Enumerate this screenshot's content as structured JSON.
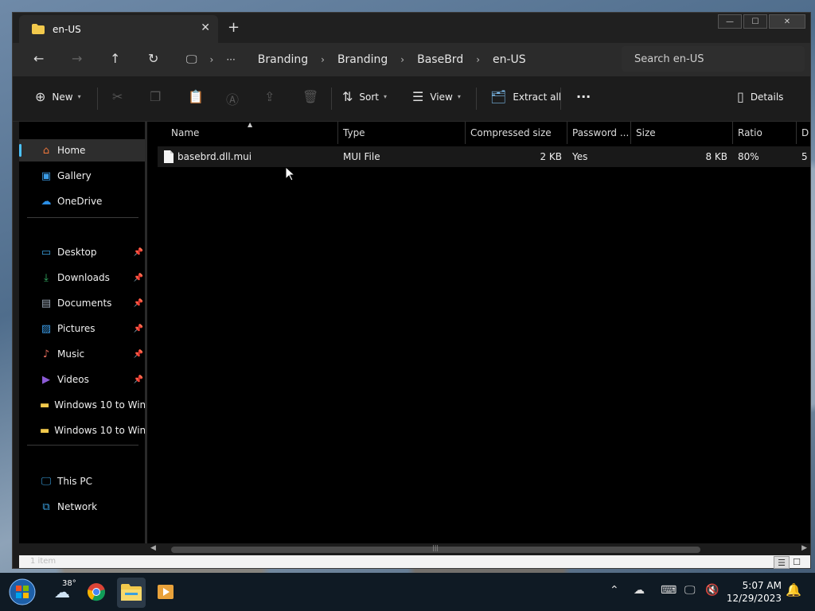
{
  "window": {
    "tab_title": "en-US",
    "tab_close": "✕",
    "new_tab": "+",
    "controls": {
      "minimize": "—",
      "maximize": "☐",
      "close": "✕"
    }
  },
  "nav": {
    "back": "←",
    "forward": "→",
    "up": "↑",
    "refresh": "↻",
    "monitor": "🖵",
    "more": "···",
    "breadcrumb": [
      "Branding",
      "Branding",
      "BaseBrd",
      "en-US"
    ],
    "search_placeholder": "Search en-US"
  },
  "commandbar": {
    "new_label": "New",
    "sort_label": "Sort",
    "view_label": "View",
    "extract_label": "Extract all",
    "more": "···",
    "details_label": "Details"
  },
  "sidebar": {
    "items_top": [
      {
        "label": "Home",
        "icon": "home-icon",
        "color": "#e8743b",
        "selected": true
      },
      {
        "label": "Gallery",
        "icon": "gallery-icon",
        "color": "#3b9de8"
      },
      {
        "label": "OneDrive",
        "icon": "cloud-icon",
        "color": "#2b8fe6"
      }
    ],
    "items_pinned": [
      {
        "label": "Desktop",
        "icon": "desktop-icon",
        "color": "#3aa0e0"
      },
      {
        "label": "Downloads",
        "icon": "download-icon",
        "color": "#37b86a"
      },
      {
        "label": "Documents",
        "icon": "documents-icon",
        "color": "#9aa7b5"
      },
      {
        "label": "Pictures",
        "icon": "pictures-icon",
        "color": "#3b9de8"
      },
      {
        "label": "Music",
        "icon": "music-icon",
        "color": "#e36c5b"
      },
      {
        "label": "Videos",
        "icon": "videos-icon",
        "color": "#8c5bd6"
      },
      {
        "label": "Windows 10 to Win",
        "icon": "folder-icon",
        "color": "#f2c94c"
      },
      {
        "label": "Windows 10 to Win",
        "icon": "folder-icon",
        "color": "#f2c94c"
      }
    ],
    "items_bottom": [
      {
        "label": "This PC",
        "icon": "computer-icon",
        "color": "#3aa0e0"
      },
      {
        "label": "Network",
        "icon": "network-icon",
        "color": "#3aa0e0"
      }
    ],
    "pin_glyph": "📌"
  },
  "columns": [
    "Name",
    "Type",
    "Compressed size",
    "Password ...",
    "Size",
    "Ratio",
    "D"
  ],
  "rows": [
    {
      "name": "basebrd.dll.mui",
      "type": "MUI File",
      "compressed": "2 KB",
      "password": "Yes",
      "size": "8 KB",
      "ratio": "80%",
      "date": "5"
    }
  ],
  "statusbar": {
    "text": "1 item"
  },
  "taskbar": {
    "weather_temp": "38°",
    "time": "5:07 AM",
    "date": "12/29/2023"
  }
}
